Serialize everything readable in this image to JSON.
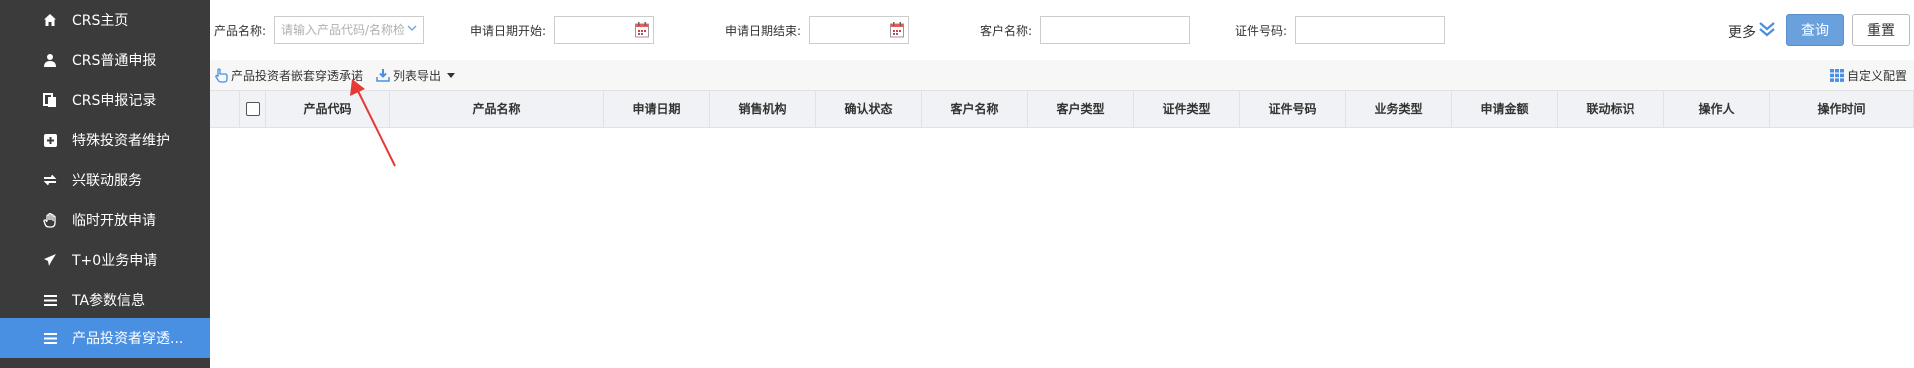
{
  "sidebar": {
    "items": [
      {
        "label": "CRS主页",
        "icon": "home-icon"
      },
      {
        "label": "CRS普通申报",
        "icon": "user-icon"
      },
      {
        "label": "CRS申报记录",
        "icon": "document-icon"
      },
      {
        "label": "特殊投资者维护",
        "icon": "plus-square-icon"
      },
      {
        "label": "兴联动服务",
        "icon": "exchange-icon"
      },
      {
        "label": "临时开放申请",
        "icon": "hand-icon"
      },
      {
        "label": "T+0业务申请",
        "icon": "paper-plane-icon"
      },
      {
        "label": "TA参数信息",
        "icon": "list-icon"
      },
      {
        "label": "产品投资者穿透...",
        "icon": "list-icon",
        "active": true
      }
    ]
  },
  "filters": {
    "product_name_label": "产品名称:",
    "product_name_placeholder": "请输入产品代码/名称检",
    "start_date_label": "申请日期开始:",
    "end_date_label": "申请日期结束:",
    "customer_name_label": "客户名称:",
    "cert_no_label": "证件号码:",
    "more_label": "更多",
    "query_label": "查询",
    "reset_label": "重置"
  },
  "toolbar": {
    "nested_label": "产品投资者嵌套穿透承诺",
    "export_label": "列表导出",
    "custom_config_label": "自定义配置"
  },
  "table": {
    "columns": [
      "产品代码",
      "产品名称",
      "申请日期",
      "销售机构",
      "确认状态",
      "客户名称",
      "客户类型",
      "证件类型",
      "证件号码",
      "业务类型",
      "申请金额",
      "联动标识",
      "操作人",
      "操作时间"
    ]
  },
  "colors": {
    "sidebar_bg": "#3b3b3b",
    "sidebar_active": "#4a90e2",
    "primary_button": "#6aa0dc",
    "annotation_arrow": "#e53935"
  }
}
